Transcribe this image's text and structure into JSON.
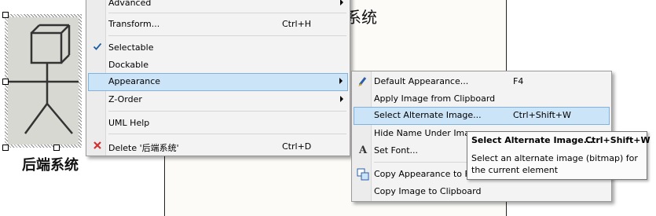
{
  "diagram": {
    "boundary_title": "系统",
    "element_label": "后端系统"
  },
  "context_menu": {
    "items": [
      {
        "label": "Advanced",
        "has_submenu": true
      },
      {
        "label": "Transform...",
        "shortcut": "Ctrl+H"
      },
      {
        "label": "Selectable",
        "checked": true
      },
      {
        "label": "Dockable"
      },
      {
        "label": "Appearance",
        "has_submenu": true,
        "highlighted": true
      },
      {
        "label": "Z-Order",
        "has_submenu": true
      },
      {
        "label": "UML Help"
      },
      {
        "label": "Delete '后端系统'",
        "shortcut": "Ctrl+D",
        "icon": "delete-icon"
      }
    ]
  },
  "appearance_submenu": {
    "items": [
      {
        "label": "Default Appearance...",
        "shortcut": "F4",
        "icon": "paint-brush-icon"
      },
      {
        "label": "Apply Image from Clipboard"
      },
      {
        "label": "Select Alternate Image...",
        "shortcut": "Ctrl+Shift+W",
        "highlighted": true
      },
      {
        "label": "Hide Name Under Image"
      },
      {
        "label": "Set Font...",
        "icon": "font-icon"
      },
      {
        "label": "Copy Appearance to F",
        "icon": "copy-appearance-icon"
      },
      {
        "label": "Copy Image to Clipboard"
      }
    ]
  },
  "tooltip": {
    "title": "Select Alternate Image...",
    "shortcut": "Ctrl+Shift+W",
    "description": "Select an alternate image (bitmap) for the current element"
  },
  "colors": {
    "highlight": "#cce4f7",
    "highlight_border": "#7fb2dd",
    "delete_icon": "#d23030"
  }
}
